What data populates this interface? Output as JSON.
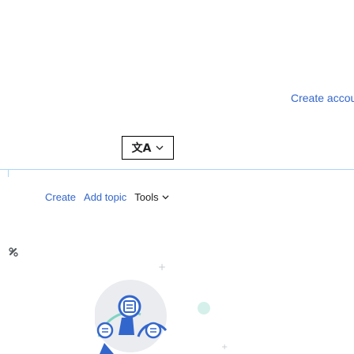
{
  "header": {
    "create_account_label": "Create account",
    "separator": "|"
  },
  "language_button": {
    "glyph": "文A",
    "icon": "translate-icon"
  },
  "actions": {
    "create_label": "Create",
    "add_topic_label": "Add topic",
    "tools_label": "Tools"
  },
  "colors": {
    "link": "#3366cc",
    "text": "#202122",
    "rule": "#a7d7f9",
    "illustration_blue": "#36c",
    "illustration_teal": "#7fd3c3"
  }
}
